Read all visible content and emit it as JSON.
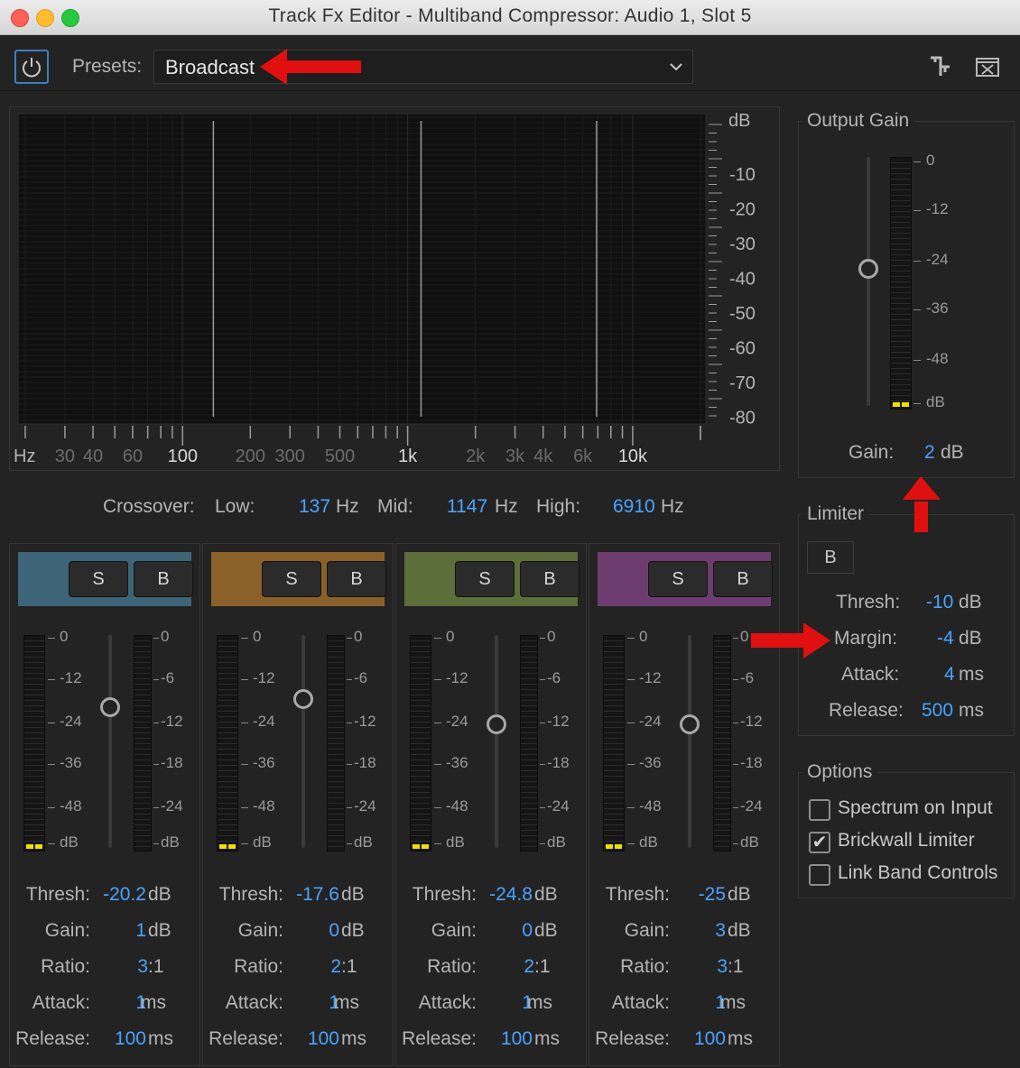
{
  "window": {
    "title": "Track Fx Editor - Multiband Compressor: Audio 1, Slot 5"
  },
  "toolbar": {
    "presets_label": "Presets:",
    "preset_value": "Broadcast"
  },
  "spectrum": {
    "db_unit": "dB",
    "db_ticks": [
      "-10",
      "-20",
      "-30",
      "-40",
      "-50",
      "-60",
      "-70",
      "-80"
    ],
    "hz_label": "Hz",
    "freq_labels_dim": [
      "30",
      "40",
      "60",
      "200",
      "300",
      "500",
      "2k",
      "3k",
      "4k",
      "6k"
    ],
    "freq_labels_bright": [
      "100",
      "1k",
      "10k"
    ]
  },
  "crossover": {
    "label": "Crossover:",
    "low_label": "Low:",
    "low_value": "137",
    "low_unit": "Hz",
    "mid_label": "Mid:",
    "mid_value": "1147",
    "mid_unit": "Hz",
    "high_label": "High:",
    "high_value": "6910",
    "high_unit": "Hz"
  },
  "bands": [
    {
      "color": "#3e6478",
      "solo": "S",
      "bypass": "B",
      "slider_level": 0.34,
      "meter_scale": [
        "0",
        "-12",
        "-24",
        "-36",
        "-48",
        "dB"
      ],
      "gr_scale": [
        "0",
        "-6",
        "-12",
        "-18",
        "-24",
        "dB"
      ],
      "labels": {
        "thresh": "Thresh:",
        "gain": "Gain:",
        "ratio": "Ratio:",
        "attack": "Attack:",
        "release": "Release:"
      },
      "thresh": "-20.2",
      "thresh_unit": "dB",
      "gain": "1",
      "gain_unit": "dB",
      "ratio": "3",
      "ratio_unit": ":1",
      "attack": "1",
      "attack_unit": "ms",
      "release": "100",
      "release_unit": "ms"
    },
    {
      "color": "#8a6129",
      "solo": "S",
      "bypass": "B",
      "slider_level": 0.3,
      "meter_scale": [
        "0",
        "-12",
        "-24",
        "-36",
        "-48",
        "dB"
      ],
      "gr_scale": [
        "0",
        "-6",
        "-12",
        "-18",
        "-24",
        "dB"
      ],
      "labels": {
        "thresh": "Thresh:",
        "gain": "Gain:",
        "ratio": "Ratio:",
        "attack": "Attack:",
        "release": "Release:"
      },
      "thresh": "-17.6",
      "thresh_unit": "dB",
      "gain": "0",
      "gain_unit": "dB",
      "ratio": "2",
      "ratio_unit": ":1",
      "attack": "1",
      "attack_unit": "ms",
      "release": "100",
      "release_unit": "ms"
    },
    {
      "color": "#5c6e3a",
      "solo": "S",
      "bypass": "B",
      "slider_level": 0.42,
      "meter_scale": [
        "0",
        "-12",
        "-24",
        "-36",
        "-48",
        "dB"
      ],
      "gr_scale": [
        "0",
        "-6",
        "-12",
        "-18",
        "-24",
        "dB"
      ],
      "labels": {
        "thresh": "Thresh:",
        "gain": "Gain:",
        "ratio": "Ratio:",
        "attack": "Attack:",
        "release": "Release:"
      },
      "thresh": "-24.8",
      "thresh_unit": "dB",
      "gain": "0",
      "gain_unit": "dB",
      "ratio": "2",
      "ratio_unit": ":1",
      "attack": "1",
      "attack_unit": "ms",
      "release": "100",
      "release_unit": "ms"
    },
    {
      "color": "#6e3d70",
      "solo": "S",
      "bypass": "B",
      "slider_level": 0.42,
      "meter_scale": [
        "0",
        "-12",
        "-24",
        "-36",
        "-48",
        "dB"
      ],
      "gr_scale": [
        "0",
        "-6",
        "-12",
        "-18",
        "-24",
        "dB"
      ],
      "labels": {
        "thresh": "Thresh:",
        "gain": "Gain:",
        "ratio": "Ratio:",
        "attack": "Attack:",
        "release": "Release:"
      },
      "thresh": "-25",
      "thresh_unit": "dB",
      "gain": "3",
      "gain_unit": "dB",
      "ratio": "3",
      "ratio_unit": ":1",
      "attack": "1",
      "attack_unit": "ms",
      "release": "100",
      "release_unit": "ms"
    }
  ],
  "output_gain": {
    "title": "Output Gain",
    "scale": [
      "0",
      "-12",
      "-24",
      "-36",
      "-48",
      "dB"
    ],
    "slider_level": 0.45,
    "gain_label": "Gain:",
    "gain_value": "2",
    "gain_unit": "dB"
  },
  "limiter": {
    "title": "Limiter",
    "bypass": "B",
    "thresh_label": "Thresh:",
    "thresh_value": "-10",
    "thresh_unit": "dB",
    "margin_label": "Margin:",
    "margin_value": "-4",
    "margin_unit": "dB",
    "attack_label": "Attack:",
    "attack_value": "4",
    "attack_unit": "ms",
    "release_label": "Release:",
    "release_value": "500",
    "release_unit": "ms"
  },
  "options": {
    "title": "Options",
    "items": [
      {
        "label": "Spectrum on Input",
        "checked": false
      },
      {
        "label": "Brickwall Limiter",
        "checked": true
      },
      {
        "label": "Link Band Controls",
        "checked": false
      }
    ]
  },
  "colors": {
    "accent": "#4aa3ff",
    "annotation": "#e01010",
    "meter_led": "#f2e000"
  }
}
